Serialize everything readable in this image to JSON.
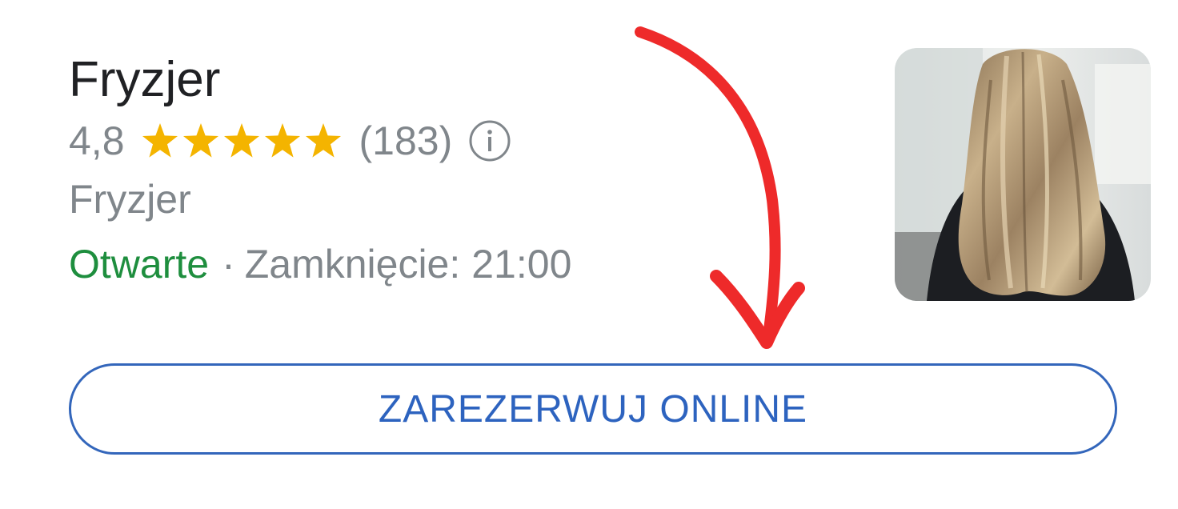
{
  "listing": {
    "title": "Fryzjer",
    "rating": "4,8",
    "stars": {
      "value": 4.8,
      "max": 5,
      "color": "#f4b400",
      "icon": "star-icon"
    },
    "review_count": "(183)",
    "info_icon": "info-icon",
    "category": "Fryzjer",
    "status": "Otwarte",
    "separator": "·",
    "closing_label": "Zamknięcie:",
    "closing_time": "21:00",
    "thumbnail": "hair-salon-photo"
  },
  "actions": {
    "book_label": "ZAREZERWUJ ONLINE"
  },
  "annotation": {
    "arrow_icon": "red-arrow-annotation",
    "arrow_color": "#ee2a2a"
  },
  "colors": {
    "title": "#202124",
    "muted": "#80868b",
    "open": "#1e8e3e",
    "accent": "#2d63bf"
  }
}
